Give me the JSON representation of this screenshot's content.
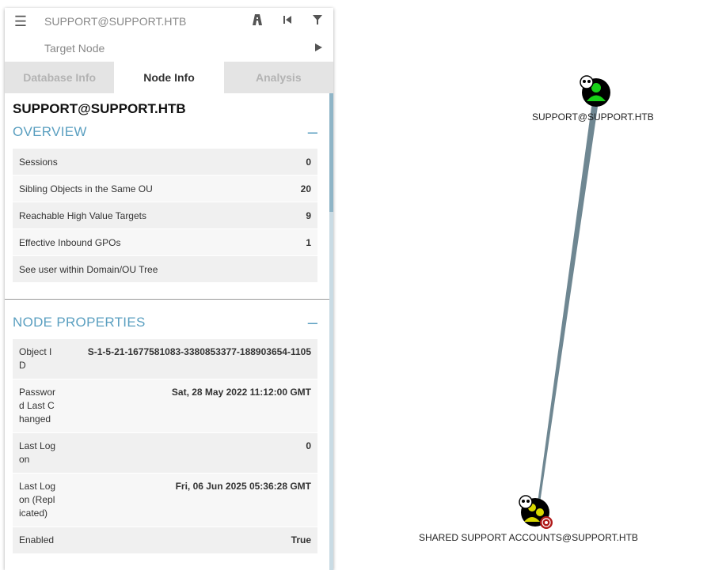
{
  "search": {
    "source_value": "SUPPORT@SUPPORT.HTB",
    "target_placeholder": "Target Node"
  },
  "tabs": [
    {
      "label": "Database Info"
    },
    {
      "label": "Node Info"
    },
    {
      "label": "Analysis"
    }
  ],
  "node": {
    "title": "SUPPORT@SUPPORT.HTB"
  },
  "overview": {
    "title": "OVERVIEW",
    "rows": [
      {
        "label": "Sessions",
        "value": "0"
      },
      {
        "label": "Sibling Objects in the Same OU",
        "value": "20"
      },
      {
        "label": "Reachable High Value Targets",
        "value": "9"
      },
      {
        "label": "Effective Inbound GPOs",
        "value": "1"
      },
      {
        "label": "See user within Domain/OU Tree",
        "value": ""
      }
    ]
  },
  "properties": {
    "title": "NODE PROPERTIES",
    "rows": [
      {
        "key": "Object ID",
        "value": "S-1-5-21-1677581083-3380853377-188903654-1105"
      },
      {
        "key": "Password Last Changed",
        "value": "Sat, 28 May 2022 11:12:00 GMT"
      },
      {
        "key": "Last Logon",
        "value": "0"
      },
      {
        "key": "Last Logon (Replicated)",
        "value": "Fri, 06 Jun 2025 05:36:28 GMT"
      },
      {
        "key": "Enabled",
        "value": "True"
      }
    ]
  },
  "graph": {
    "nodes": [
      {
        "label": "SUPPORT@SUPPORT.HTB",
        "kind": "user",
        "color": "#17d117"
      },
      {
        "label": "SHARED SUPPORT ACCOUNTS@SUPPORT.HTB",
        "kind": "group",
        "color": "#d8d800"
      }
    ],
    "edge_color": "#6f8792"
  },
  "colors": {
    "accent": "#5a9fc0",
    "tab_inactive": "#e4e4e4"
  }
}
